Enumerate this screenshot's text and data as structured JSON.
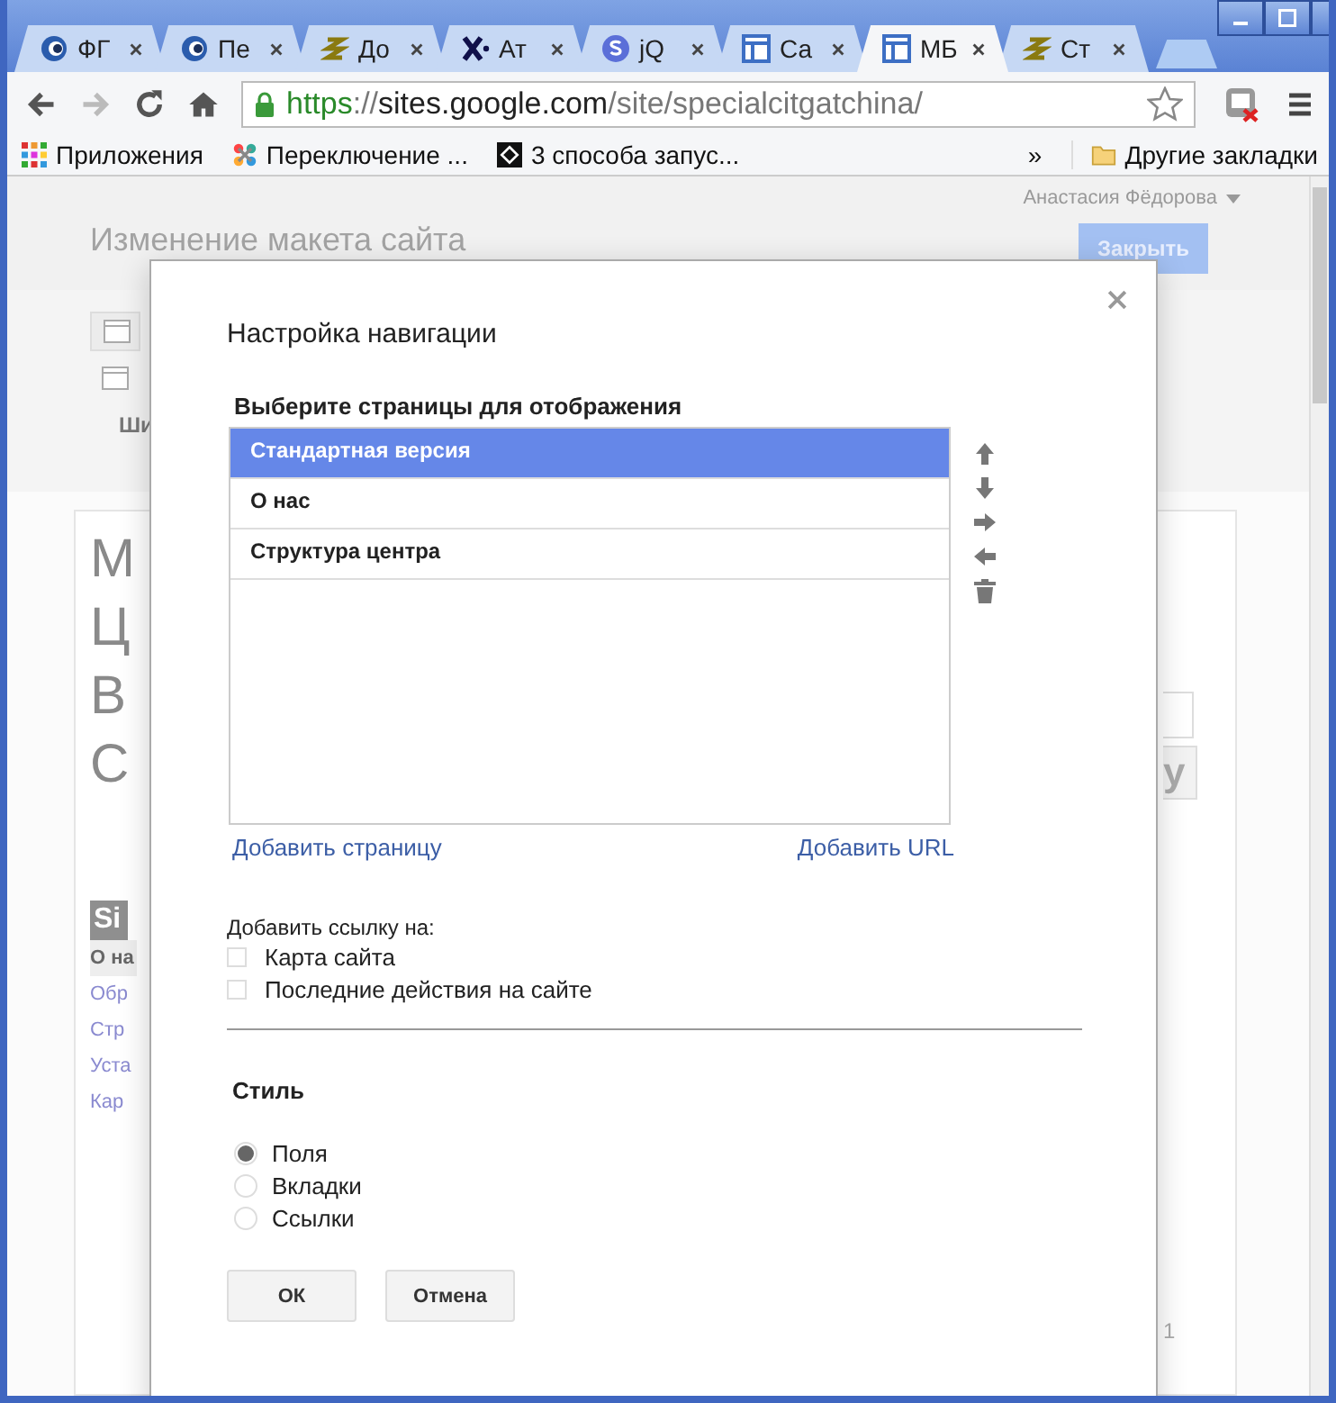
{
  "browser": {
    "tabs": [
      {
        "title": "ФГ",
        "kind": "globe",
        "selected": false
      },
      {
        "title": "Пе",
        "kind": "globe",
        "selected": false
      },
      {
        "title": "До",
        "kind": "spiral",
        "selected": false
      },
      {
        "title": "Ат",
        "kind": "xletter",
        "selected": false
      },
      {
        "title": "jQ",
        "kind": "sletter",
        "selected": false
      },
      {
        "title": "Са",
        "kind": "layout",
        "selected": false
      },
      {
        "title": "МБ",
        "kind": "layout",
        "selected": true
      },
      {
        "title": "Ст",
        "kind": "spiral",
        "selected": false
      }
    ],
    "address": {
      "scheme": "https",
      "separator": "://",
      "host": "sites.google.com",
      "path": "/site/specialcitgatchina/"
    },
    "bookmarks": [
      {
        "label": "Приложения",
        "kind": "apps"
      },
      {
        "label": "Переключение ...",
        "kind": "joomla"
      },
      {
        "label": "3 способа запус...",
        "kind": "code"
      }
    ],
    "bookmarks_more": "»",
    "other_bookmarks": "Другие закладки"
  },
  "page": {
    "user": "Анастасия Фёдорова",
    "title": "Изменение макета сайта",
    "close_button": "Закрыть",
    "toolbar_fragment": "Ши",
    "heading_fragments": [
      "М",
      "Ц",
      "В",
      "С"
    ],
    "sidebar_title_fragment": "Si",
    "sidebar_items": [
      {
        "label": "О на",
        "selected": true
      },
      {
        "label": "Обр",
        "selected": false
      },
      {
        "label": "Стр",
        "selected": false
      },
      {
        "label": "Уста",
        "selected": false
      },
      {
        "label": "Кар",
        "selected": false
      }
    ],
    "button_fragment": "у",
    "footer_fragment": "1"
  },
  "dialog": {
    "title": "Настройка навигации",
    "pages_label": "Выберите страницы для отображения",
    "pages": [
      {
        "label": "Стандартная версия",
        "selected": true
      },
      {
        "label": "О нас",
        "selected": false
      },
      {
        "label": "Структура центра",
        "selected": false
      }
    ],
    "add_page": "Добавить страницу",
    "add_url": "Добавить URL",
    "links_label": "Добавить ссылку на:",
    "link_options": [
      {
        "label": "Карта сайта",
        "checked": false
      },
      {
        "label": "Последние действия на сайте",
        "checked": false
      }
    ],
    "style_label": "Стиль",
    "styles": [
      {
        "label": "Поля",
        "selected": true
      },
      {
        "label": "Вкладки",
        "selected": false
      },
      {
        "label": "Ссылки",
        "selected": false
      }
    ],
    "buttons": [
      "ОК",
      "Отмена"
    ]
  }
}
